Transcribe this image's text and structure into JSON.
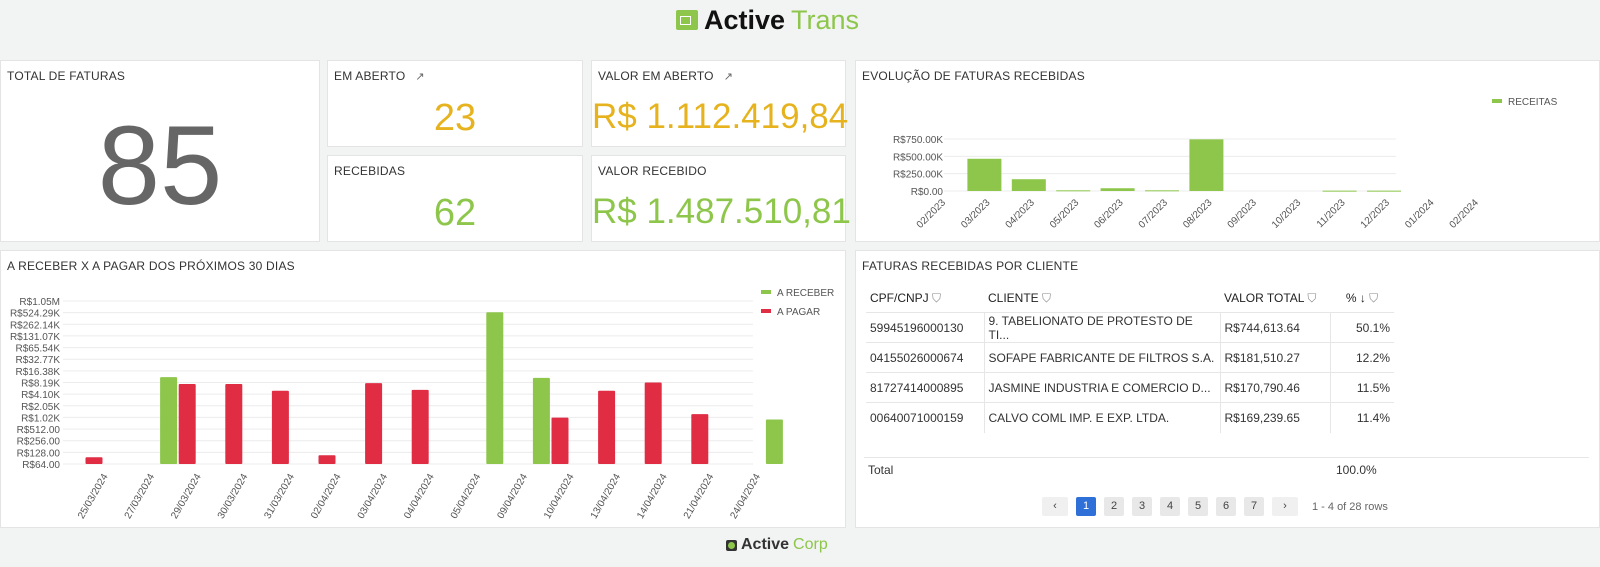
{
  "header": {
    "logo_text_1": "Active",
    "logo_text_2": "Trans"
  },
  "footer": {
    "logo_text_1": "Active",
    "logo_text_2": "Corp"
  },
  "colors": {
    "yellow": "#e6b31e",
    "green": "#8dc64b",
    "red": "#e02d44",
    "gray": "#666666"
  },
  "kpis": {
    "total": {
      "title": "TOTAL DE FATURAS",
      "value": "85"
    },
    "em_aberto": {
      "title": "EM ABERTO",
      "value": "23",
      "icon": "external-link-icon"
    },
    "recebidas": {
      "title": "RECEBIDAS",
      "value": "62"
    },
    "valor_aberto": {
      "title": "VALOR EM ABERTO",
      "value": "R$ 1.112.419,84",
      "icon": "external-link-icon"
    },
    "valor_recebido": {
      "title": "VALOR RECEBIDO",
      "value": "R$ 1.487.510,81"
    }
  },
  "chart_data": [
    {
      "title": "EVOLUÇÃO DE FATURAS RECEBIDAS",
      "type": "bar",
      "categories": [
        "02/2023",
        "03/2023",
        "04/2023",
        "05/2023",
        "06/2023",
        "07/2023",
        "08/2023",
        "09/2023",
        "10/2023",
        "11/2023",
        "12/2023",
        "01/2024",
        "02/2024"
      ],
      "series": [
        {
          "name": "RECEITAS",
          "color": "#8dc64b",
          "values": [
            0,
            465000,
            170000,
            10000,
            40000,
            10000,
            745000,
            0,
            0,
            5000,
            5000,
            0,
            0
          ]
        }
      ],
      "yticks": [
        "R$0.00",
        "R$250.00K",
        "R$500.00K",
        "R$750.00K"
      ],
      "ylim": [
        0,
        750000
      ],
      "grid": true,
      "legend": "top-right"
    },
    {
      "title": "A RECEBER X A PAGAR DOS PRÓXIMOS 30 DIAS",
      "type": "bar",
      "yscale": "log2",
      "ylim": [
        64,
        1048576
      ],
      "categories": [
        "25/03/2024",
        "27/03/2024",
        "29/03/2024",
        "30/03/2024",
        "31/03/2024",
        "02/04/2024",
        "03/04/2024",
        "04/04/2024",
        "05/04/2024",
        "09/04/2024",
        "10/04/2024",
        "13/04/2024",
        "14/04/2024",
        "21/04/2024",
        "24/04/2024"
      ],
      "series": [
        {
          "name": "A RECEBER",
          "color": "#8dc64b",
          "values": [
            null,
            11300,
            null,
            null,
            null,
            null,
            null,
            null,
            536000,
            10800,
            null,
            null,
            null,
            null,
            905
          ]
        },
        {
          "name": "A PAGAR",
          "color": "#e02d44",
          "values": [
            96,
            null,
            7500,
            7500,
            5000,
            108,
            7900,
            5300,
            null,
            null,
            1010,
            5000,
            8200,
            1250,
            null
          ]
        }
      ],
      "yticks": [
        "R$64.00",
        "R$128.00",
        "R$256.00",
        "R$512.00",
        "R$1.02K",
        "R$2.05K",
        "R$4.10K",
        "R$8.19K",
        "R$16.38K",
        "R$32.77K",
        "R$65.54K",
        "R$131.07K",
        "R$262.14K",
        "R$524.29K",
        "R$1.05M"
      ],
      "grid": true,
      "legend": "top-right"
    }
  ],
  "table": {
    "title": "FATURAS RECEBIDAS POR CLIENTE",
    "columns": [
      "CPF/CNPJ",
      "CLIENTE",
      "VALOR TOTAL",
      "%"
    ],
    "rows": [
      [
        "59945196000130",
        "9. TABELIONATO DE PROTESTO DE TI...",
        "R$744,613.64",
        "50.1%"
      ],
      [
        "04155026000674",
        "SOFAPE FABRICANTE DE FILTROS S.A.",
        "R$181,510.27",
        "12.2%"
      ],
      [
        "81727414000895",
        "JASMINE INDUSTRIA E COMERCIO D...",
        "R$170,790.46",
        "11.5%"
      ],
      [
        "00640071000159",
        "CALVO COML IMP. E EXP. LTDA.",
        "R$169,239.65",
        "11.4%"
      ]
    ],
    "total_label": "Total",
    "total_pct": "100.0%",
    "pages": [
      "1",
      "2",
      "3",
      "4",
      "5",
      "6",
      "7"
    ],
    "prev": "‹",
    "next": "›",
    "range": "1 - 4 of 28 rows"
  }
}
